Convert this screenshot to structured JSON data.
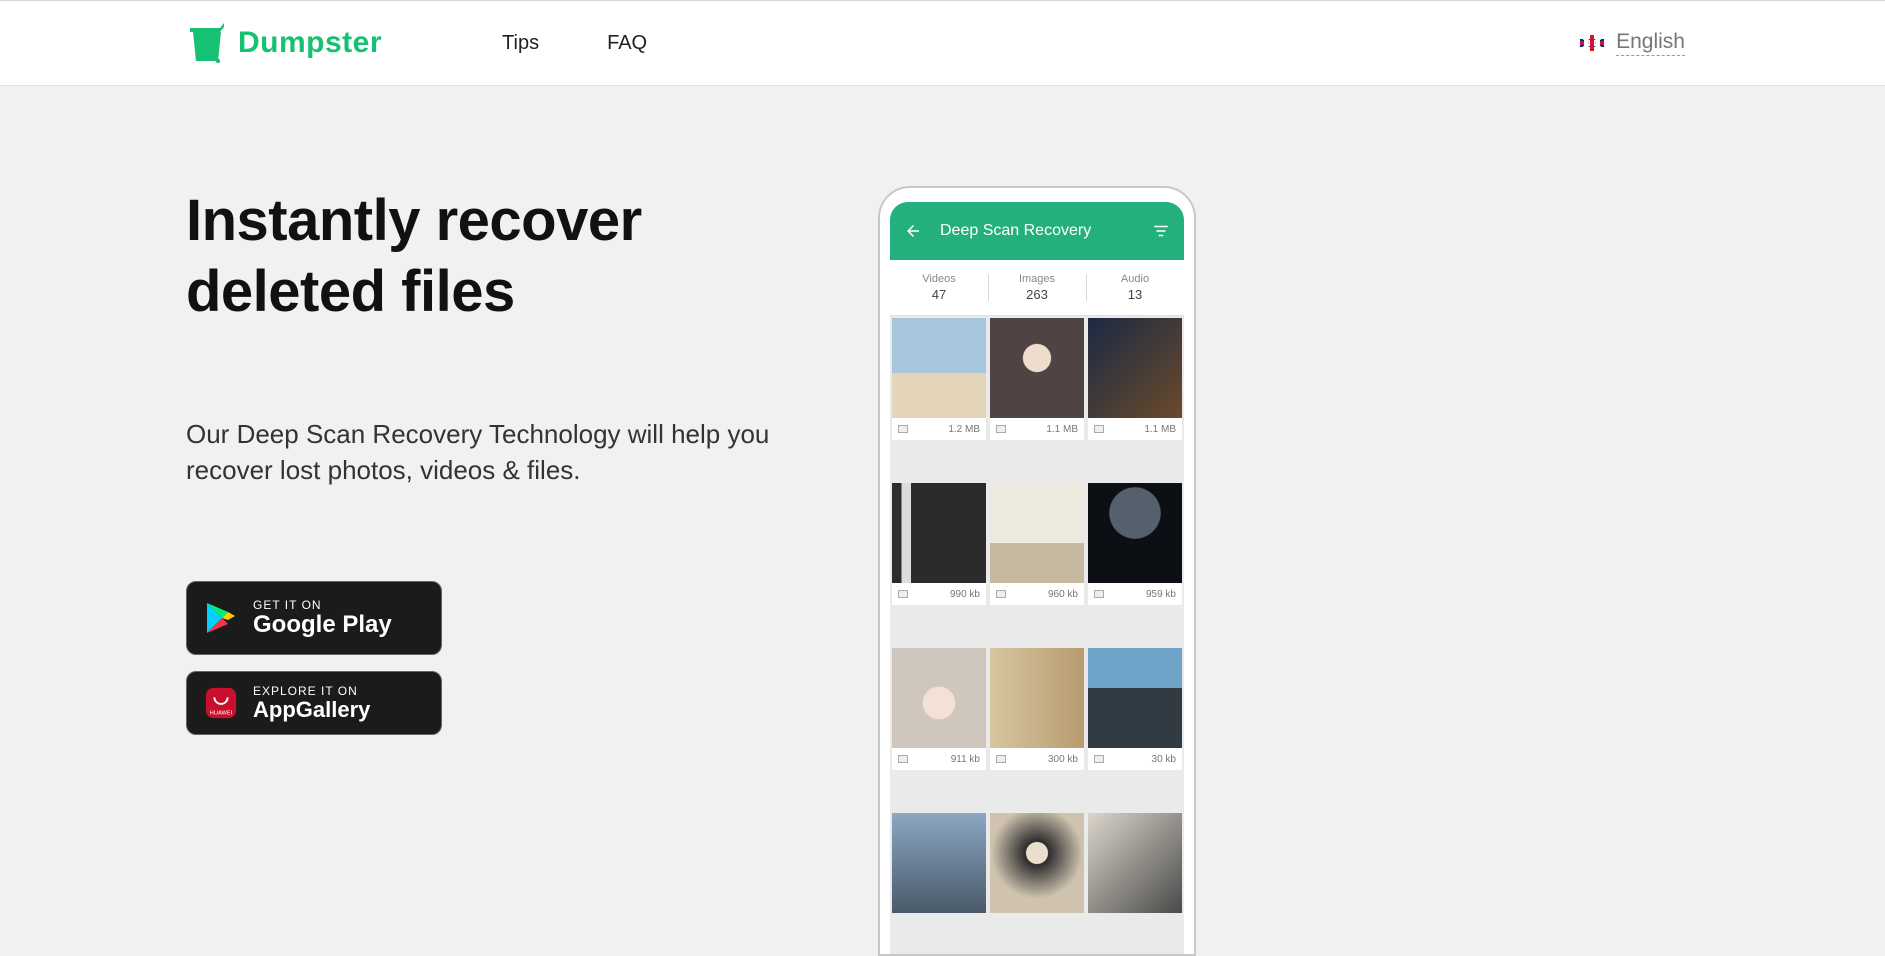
{
  "header": {
    "brand": "Dumpster",
    "nav": {
      "tips": "Tips",
      "faq": "FAQ"
    },
    "language": "English"
  },
  "hero": {
    "headline_line1": "Instantly recover",
    "headline_line2": "deleted files",
    "subhead": "Our Deep Scan Recovery Technology will help you recover lost photos, videos & files."
  },
  "store": {
    "google": {
      "top": "GET IT ON",
      "bottom": "Google Play"
    },
    "huawei": {
      "top": "EXPLORE IT ON",
      "bottom": "AppGallery",
      "badge": "HUAWEI"
    }
  },
  "phone": {
    "title": "Deep Scan Recovery",
    "stats": [
      {
        "label": "Videos",
        "value": "47"
      },
      {
        "label": "Images",
        "value": "263"
      },
      {
        "label": "Audio",
        "value": "13"
      }
    ],
    "tiles": [
      {
        "size": "1.2 MB"
      },
      {
        "size": "1.1 MB"
      },
      {
        "size": "1.1 MB"
      },
      {
        "size": "990 kb"
      },
      {
        "size": "960 kb"
      },
      {
        "size": "959 kb"
      },
      {
        "size": "911 kb"
      },
      {
        "size": "300 kb"
      },
      {
        "size": "30 kb"
      },
      {
        "size": ""
      },
      {
        "size": ""
      },
      {
        "size": ""
      }
    ]
  }
}
